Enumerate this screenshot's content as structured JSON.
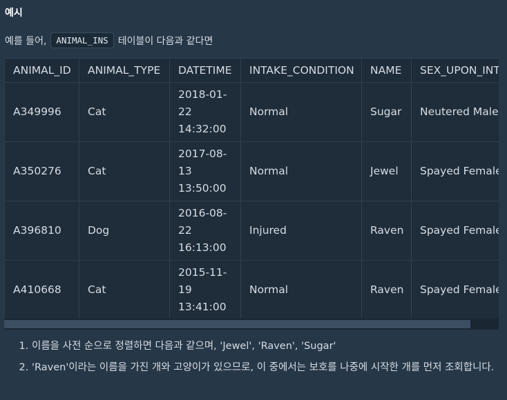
{
  "heading": "예시",
  "intro": {
    "before": "예를 들어,",
    "code": "ANIMAL_INS",
    "after": "테이블이 다음과 같다면"
  },
  "table": {
    "columns": [
      "ANIMAL_ID",
      "ANIMAL_TYPE",
      "DATETIME",
      "INTAKE_CONDITION",
      "NAME",
      "SEX_UPON_INT"
    ],
    "rows": [
      [
        "A349996",
        "Cat",
        "2018-01-22 14:32:00",
        "Normal",
        "Sugar",
        "Neutered Male"
      ],
      [
        "A350276",
        "Cat",
        "2017-08-13 13:50:00",
        "Normal",
        "Jewel",
        "Spayed Female"
      ],
      [
        "A396810",
        "Dog",
        "2016-08-22 16:13:00",
        "Injured",
        "Raven",
        "Spayed Female"
      ],
      [
        "A410668",
        "Cat",
        "2015-11-19 13:41:00",
        "Normal",
        "Raven",
        "Spayed Female"
      ]
    ]
  },
  "notes": [
    "이름을 사전 순으로 정렬하면 다음과 같으며, 'Jewel', 'Raven', 'Sugar'",
    "'Raven'이라는 이름을 가진 개와 고양이가 있으므로, 이 중에서는 보호를 나중에 시작한 개를 먼저 조회합니다."
  ]
}
